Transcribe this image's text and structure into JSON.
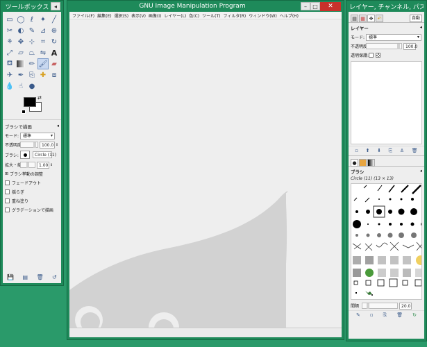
{
  "toolbox": {
    "title": "ツールボックス",
    "tool_options_title": "ブラシで描画",
    "mode_label": "モード:",
    "mode_value": "標準",
    "opacity_label": "不透明度:",
    "opacity_value": "100.0",
    "brush_label": "ブラシ:",
    "brush_value": "Circle (11)",
    "scale_label": "拡大・縮小:",
    "scale_value": "1.00",
    "dynamics_label": "ブラシ挙動の調整",
    "options": [
      "フェードアウト",
      "揺らぎ",
      "重ね塗り",
      "グラデーションで描画"
    ]
  },
  "mainwin": {
    "title": "GNU Image Manipulation Program",
    "menu": [
      "ファイル(F)",
      "編集(E)",
      "選択(S)",
      "表示(V)",
      "画像(I)",
      "レイヤー(L)",
      "色(C)",
      "ツール(T)",
      "フィルタ(R)",
      "ウィンドウ(W)",
      "ヘルプ(H)"
    ]
  },
  "dock": {
    "title": "レイヤー, チャンネル, パス, ア...",
    "auto_label": "自動",
    "layers_title": "レイヤー",
    "layers_mode_label": "モード:",
    "layers_mode_value": "標準",
    "layers_opacity_label": "不透明度:",
    "layers_opacity_value": "100.0",
    "lock_label": "透明保護:",
    "brushes_title": "ブラシ",
    "brush_info": "Circle (11) (13 × 13)",
    "spacing_label": "間隔",
    "spacing_value": "20.0"
  },
  "colors": {
    "foreground": "#000000",
    "background": "#ffffff",
    "wilber": "#d2d2d2",
    "window_frame": "#1e8a5a"
  }
}
